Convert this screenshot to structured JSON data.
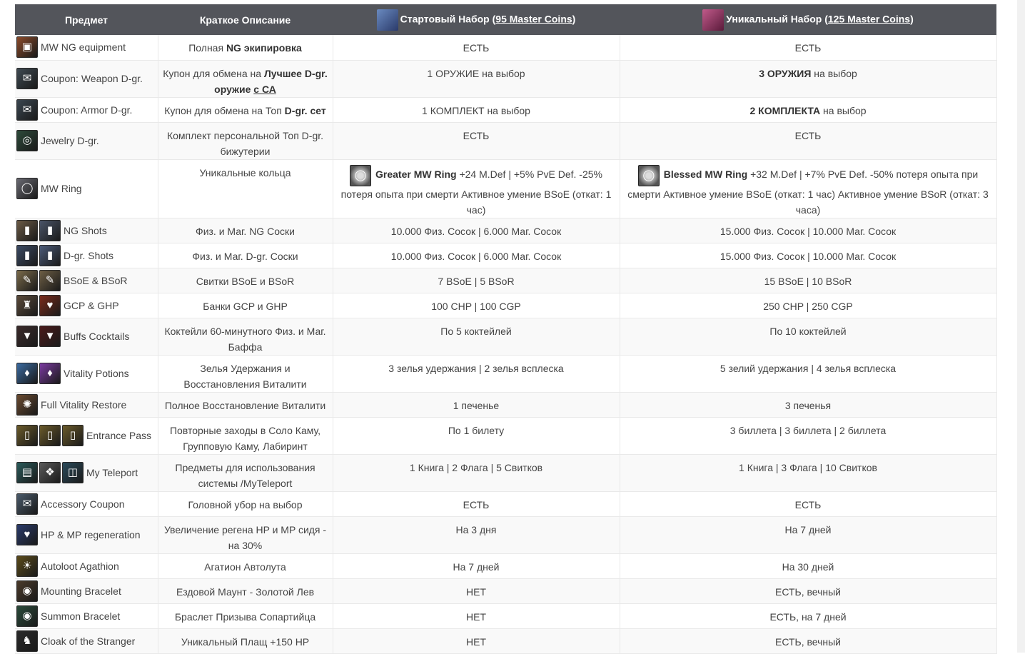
{
  "header": {
    "col_item": "Предмет",
    "col_desc": "Краткое Описание",
    "col_start_prefix": "Стартовый Набор (",
    "col_start_coins": "95 Master Coins",
    "col_start_suffix": ")",
    "col_unique_prefix": "Уникальный Набор (",
    "col_unique_coins": "125 Master Coins",
    "col_unique_suffix": ")"
  },
  "rows": [
    {
      "name": "MW NG equipment",
      "desc_pre": "Полная ",
      "desc_b": "NG экипировка",
      "start": "ЕСТЬ",
      "unique": "ЕСТЬ"
    },
    {
      "name": "Coupon: Weapon D-gr.",
      "desc_pre": "Купон для обмена на ",
      "desc_b": "Лучшее D-gr. оружие ",
      "desc_u": "с СА",
      "start": "1 ОРУЖИЕ на выбор",
      "unique_b": "3 ОРУЖИЯ",
      "unique_post": " на выбор"
    },
    {
      "name": "Coupon: Armor D-gr.",
      "desc_pre": "Купон для обмена на Топ ",
      "desc_b": "D-gr. сет",
      "start": "1 КОМПЛЕКТ на выбор",
      "unique_b": "2 КОМПЛЕКТА",
      "unique_post": " на выбор"
    },
    {
      "name": "Jewelry D-gr.",
      "desc": "Комплект персональной Топ D-gr. бижутерии",
      "start": "ЕСТЬ",
      "unique": "ЕСТЬ"
    },
    {
      "name": "MW Ring",
      "desc": "Уникальные кольца",
      "start_b": "Greater MW Ring",
      "start_rest": " +24 M.Def | +5% PvE Def. -25% потеря опыта при смерти Активное умение BSoE (откат: 1 час)",
      "unique_b": "Blessed MW Ring",
      "unique_rest": " +32 M.Def | +7% PvE Def. -50% потеря опыта при смерти Активное умение BSoE (откат: 1 час) Активное умение BSoR (откат: 3 часа)"
    },
    {
      "name": "NG Shots",
      "desc": "Физ. и Маг. NG Соски",
      "start": "10.000 Физ. Сосок | 6.000 Маг. Сосок",
      "unique": "15.000 Физ. Сосок | 10.000 Маг. Сосок"
    },
    {
      "name": "D-gr. Shots",
      "desc": "Физ. и Маг. D-gr. Соски",
      "start": "10.000 Физ. Сосок | 6.000 Маг. Сосок",
      "unique": "15.000 Физ. Сосок | 10.000 Маг. Сосок"
    },
    {
      "name": "BSoE & BSoR",
      "desc": "Свитки BSoE и BSoR",
      "start": "7 BSoE | 5 BSoR",
      "unique": "15 BSoE | 10 BSoR"
    },
    {
      "name": "GCP & GHP",
      "desc": "Банки GCP и GHP",
      "start": "100 CHP | 100 CGP",
      "unique": "250 CHP | 250 CGP"
    },
    {
      "name": "Buffs Cocktails",
      "desc": "Коктейли 60-минутного Физ. и Маг. Баффа",
      "start": "По 5 коктейлей",
      "unique": "По 10 коктейлей"
    },
    {
      "name": "Vitality Potions",
      "desc": "Зелья Удержания и Восстановления Виталити",
      "start": "3 зелья удержания | 2 зелья всплеска",
      "unique": "5 зелий удержания | 4 зелья всплеска"
    },
    {
      "name": "Full Vitality Restore",
      "desc": "Полное Восстановление Виталити",
      "start": "1 печенье",
      "unique": "3 печенья"
    },
    {
      "name": "Entrance Pass",
      "desc": "Повторные заходы в Соло Каму, Групповую Каму, Лабиринт",
      "start": "По 1 билету",
      "unique": "3 биллета | 3 биллета | 2 биллета"
    },
    {
      "name": "My Teleport",
      "desc": "Предметы для использования системы /MyTeleport",
      "start": "1 Книга | 2 Флага | 5 Свитков",
      "unique": "1 Книга | 3 Флага | 10 Свитков"
    },
    {
      "name": "Accessory Coupon",
      "desc": "Головной убор на выбор",
      "start": "ЕСТЬ",
      "unique": "ЕСТЬ"
    },
    {
      "name": "HP & MP regeneration",
      "desc": "Увеличение регена HP и MP сидя - на 30%",
      "start": "На 3 дня",
      "unique": "На 7 дней"
    },
    {
      "name": "Autoloot Agathion",
      "desc": "Агатион Автолута",
      "start": "На 7 дней",
      "unique": "На 30 дней"
    },
    {
      "name": "Mounting Bracelet",
      "desc": "Ездовой Маунт - Золотой Лев",
      "start": "НЕТ",
      "unique": "ЕСТЬ, вечный"
    },
    {
      "name": "Summon Bracelet",
      "desc": "Браслет Призыва Сопартийца",
      "start": "НЕТ",
      "unique": "ЕСТЬ, на 7 дней"
    },
    {
      "name": "Cloak of the Stranger",
      "desc": "Уникальный Плащ +150 HP",
      "start": "НЕТ",
      "unique": "ЕСТЬ, вечный"
    }
  ],
  "icons": [
    {
      "names": [
        "chest-equipment-icon"
      ],
      "colors": [
        "#8a4a2a"
      ],
      "glyph": [
        "▣"
      ]
    },
    {
      "names": [
        "weapon-coupon-icon"
      ],
      "colors": [
        "#3f4a52"
      ],
      "glyph": [
        "✉"
      ]
    },
    {
      "names": [
        "armor-coupon-icon"
      ],
      "colors": [
        "#3a4650"
      ],
      "glyph": [
        "✉"
      ]
    },
    {
      "names": [
        "jewelry-icon"
      ],
      "colors": [
        "#2d4a3a"
      ],
      "glyph": [
        "◎"
      ]
    },
    {
      "names": [
        "ring-icon"
      ],
      "colors": [
        "#6a6a72"
      ],
      "glyph": [
        "◯"
      ]
    },
    {
      "names": [
        "ng-shot-phys-icon",
        "ng-shot-mag-icon"
      ],
      "colors": [
        "#6b5a45",
        "#4a5468"
      ],
      "glyph": [
        "▮",
        "▮"
      ]
    },
    {
      "names": [
        "dgr-shot-phys-icon",
        "dgr-shot-mag-icon"
      ],
      "colors": [
        "#3b4a63",
        "#4b5a78"
      ],
      "glyph": [
        "▮",
        "▮"
      ]
    },
    {
      "names": [
        "bsoe-scroll-icon",
        "bsor-scroll-icon"
      ],
      "colors": [
        "#7a6a4a",
        "#6d5e44"
      ],
      "glyph": [
        "✎",
        "✎"
      ]
    },
    {
      "names": [
        "gcp-potion-icon",
        "ghp-potion-icon"
      ],
      "colors": [
        "#5a4a3a",
        "#7a2a1a"
      ],
      "glyph": [
        "♜",
        "♥"
      ]
    },
    {
      "names": [
        "cocktail-phys-icon",
        "cocktail-mag-icon"
      ],
      "colors": [
        "#3a2a2a",
        "#4a1a1a"
      ],
      "glyph": [
        "▼",
        "▼"
      ]
    },
    {
      "names": [
        "vitality-potion-blue-icon",
        "vitality-potion-purple-icon"
      ],
      "colors": [
        "#3a6aa0",
        "#7a3aa0"
      ],
      "glyph": [
        "♦",
        "♦"
      ]
    },
    {
      "names": [
        "cookie-icon"
      ],
      "colors": [
        "#6a4a30"
      ],
      "glyph": [
        "✺"
      ]
    },
    {
      "names": [
        "pass-icon-1",
        "pass-icon-2",
        "pass-icon-3"
      ],
      "colors": [
        "#6a5a2a",
        "#6a5a2a",
        "#6a5a2a"
      ],
      "glyph": [
        "▯",
        "▯",
        "▯"
      ]
    },
    {
      "names": [
        "teleport-book-icon",
        "teleport-flag-icon",
        "teleport-scroll-icon"
      ],
      "colors": [
        "#2a5a5a",
        "#5a5a5a",
        "#2a4a5a"
      ],
      "glyph": [
        "▤",
        "❖",
        "◫"
      ]
    },
    {
      "names": [
        "accessory-coupon-icon"
      ],
      "colors": [
        "#4a5a6a"
      ],
      "glyph": [
        "✉"
      ]
    },
    {
      "names": [
        "hp-mp-regen-icon"
      ],
      "colors": [
        "#2a3a6a"
      ],
      "glyph": [
        "♥"
      ]
    },
    {
      "names": [
        "agathion-icon"
      ],
      "colors": [
        "#5a4a1a"
      ],
      "glyph": [
        "☀"
      ]
    },
    {
      "names": [
        "mount-bracelet-icon"
      ],
      "colors": [
        "#4a3a2a"
      ],
      "glyph": [
        "◉"
      ]
    },
    {
      "names": [
        "summon-bracelet-icon"
      ],
      "colors": [
        "#2a4a3a"
      ],
      "glyph": [
        "◉"
      ]
    },
    {
      "names": [
        "cloak-icon"
      ],
      "colors": [
        "#2a2a2a"
      ],
      "glyph": [
        "♞"
      ]
    }
  ],
  "colors": {
    "header_bg": "#53555b",
    "start_chest": "#3a5a9a",
    "unique_chest": "#8a2a4a"
  }
}
